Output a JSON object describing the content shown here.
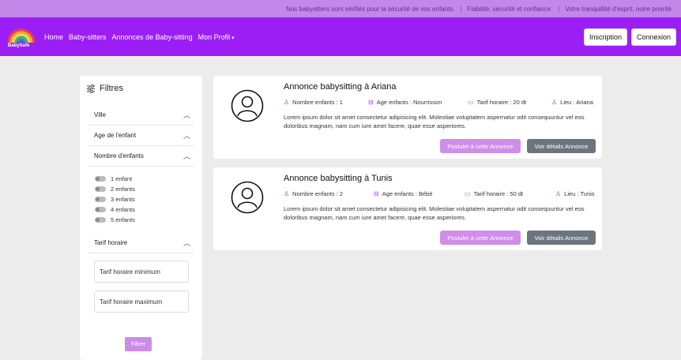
{
  "topbar": {
    "messages": [
      "Nos babysitters sont vérifiés pour la sécurité de vos enfants.",
      "Fiabilité, sécurité et confiance.",
      "Votre tranquillité d'esprit, notre priorité."
    ],
    "separator": "|"
  },
  "brand": {
    "logo_text": "BabySafe"
  },
  "nav": {
    "links": [
      "Home",
      "Baby-sitters",
      "Annonces de Baby-sitting",
      "Mon Profil"
    ],
    "profile_caret": "▾",
    "inscription": "Inscription",
    "connexion": "Connexion"
  },
  "sidebar": {
    "title": "Filtres",
    "sections": {
      "ville": "Ville",
      "age": "Age de l'enfant",
      "nombre": "Nombre d'enfants",
      "tarif": "Tarif horaire"
    },
    "chevron": "︿",
    "children_options": [
      "1 enfant",
      "2 enfants",
      "3 enfants",
      "4 enfants",
      "5 enfants"
    ],
    "tarif_min_placeholder": "Tarif horaire minimum",
    "tarif_max_placeholder": "Tarif horaire maximum",
    "filter_button": "Filtrer"
  },
  "annonces": [
    {
      "title": "Annonce babysitting à Ariana",
      "nombre_enfants": "Nombre enfants : 1",
      "age_enfants": "Age enfants : Nourrisson",
      "tarif": "Tarif horaire : 20 dt",
      "lieu": "Lieu : Ariana",
      "description": "Lorem ipsum dolor sit amet consectetur adipisicing elit. Molestiae voluptatem aspernatur odit consequuntur vel eos doloribus magnam, nam cum iure amet facere, quae esse asperiores.",
      "postuler": "Postuler à cette Annonce",
      "details": "Voir détails Annonce"
    },
    {
      "title": "Annonce babysitting à Tunis",
      "nombre_enfants": "Nombre enfants : 2",
      "age_enfants": "Age enfants : Bébé",
      "tarif": "Tarif horaire : 50 dt",
      "lieu": "Lieu : Tunis",
      "description": "Lorem ipsum dolor sit amet consectetur adipisicing elit. Molestiae voluptatem aspernatur odit consequuntur vel eos doloribus magnam, nam cum iure amet facere, quae esse asperiores.",
      "postuler": "Postuler à cette Annonce",
      "details": "Voir détails Annonce"
    }
  ],
  "colors": {
    "topbar_bg": "#c287e9",
    "navbar_bg": "#9b1ff5",
    "accent": "#cf8ee9",
    "secondary_button": "#6c757d"
  },
  "icons": {
    "person": "person-icon",
    "baby": "baby-icon",
    "wallet": "wallet-icon",
    "location": "location-icon",
    "filter": "filter-icon",
    "avatar": "avatar-icon"
  }
}
